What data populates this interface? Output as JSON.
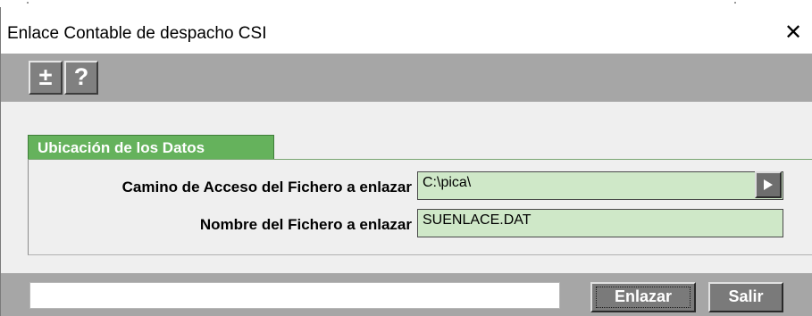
{
  "window": {
    "title": "Enlace Contable de despacho CSI",
    "close_symbol": "✕"
  },
  "toolbar": {
    "expand_label": "±",
    "help_label": "?"
  },
  "section": {
    "title": "Ubicación de los Datos"
  },
  "fields": {
    "path_label": "Camino de Acceso del Fichero a enlazar",
    "path_value": "C:\\pica\\",
    "file_label": "Nombre del Fichero a enlazar",
    "file_value": "SUENLACE.DAT"
  },
  "footer": {
    "status_text": "",
    "link_button": "Enlazar",
    "exit_button": "Salir"
  },
  "colors": {
    "section_tab": "#65b25c",
    "input_background": "#cfe8c8",
    "toolbar": "#a6a6a6",
    "body": "#efefef"
  },
  "icons": {
    "browse": "play-triangle-icon",
    "close": "close-icon"
  }
}
